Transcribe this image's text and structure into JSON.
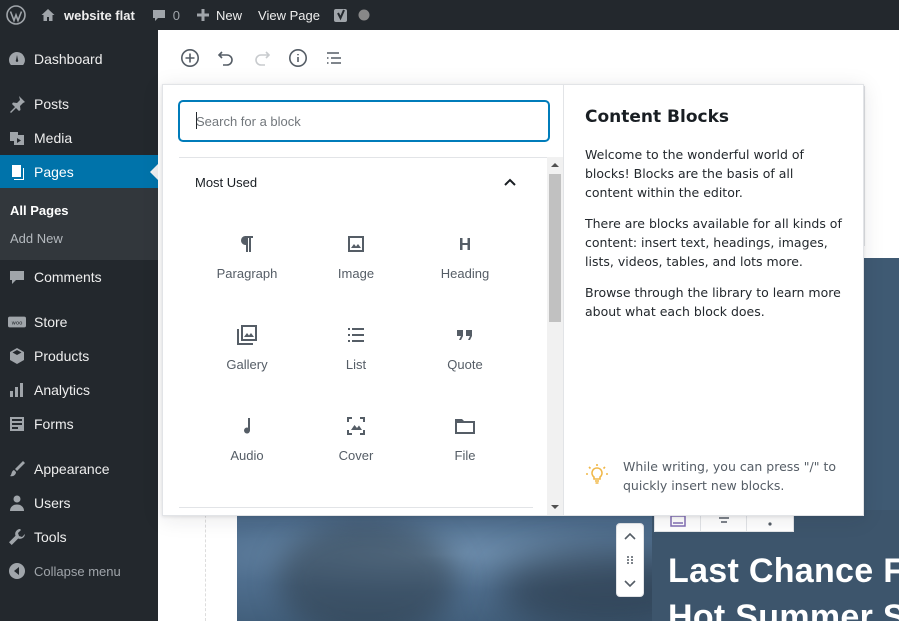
{
  "adminbar": {
    "site_name": "website flat",
    "comments_count": "0",
    "new_label": "New",
    "view_page_label": "View Page"
  },
  "sidebar": {
    "items": [
      {
        "label": "Dashboard",
        "icon": "dashboard-icon"
      },
      {
        "label": "Posts",
        "icon": "pin-icon"
      },
      {
        "label": "Media",
        "icon": "media-icon"
      },
      {
        "label": "Pages",
        "icon": "pages-icon"
      },
      {
        "label": "Comments",
        "icon": "comment-icon"
      },
      {
        "label": "Store",
        "icon": "woo-icon"
      },
      {
        "label": "Products",
        "icon": "box-icon"
      },
      {
        "label": "Analytics",
        "icon": "bar-chart-icon"
      },
      {
        "label": "Forms",
        "icon": "forms-icon"
      },
      {
        "label": "Appearance",
        "icon": "brush-icon"
      },
      {
        "label": "Users",
        "icon": "user-icon"
      },
      {
        "label": "Tools",
        "icon": "wrench-icon"
      }
    ],
    "submenu": {
      "all_pages": "All Pages",
      "add_new": "Add New"
    },
    "collapse_label": "Collapse menu",
    "accent_color": "#0073aa"
  },
  "inserter": {
    "search_placeholder": "Search for a block",
    "panel_title": "Most Used",
    "blocks": [
      {
        "label": "Paragraph",
        "icon": "paragraph-icon"
      },
      {
        "label": "Image",
        "icon": "image-icon"
      },
      {
        "label": "Heading",
        "icon": "heading-icon"
      },
      {
        "label": "Gallery",
        "icon": "gallery-icon"
      },
      {
        "label": "List",
        "icon": "list-icon"
      },
      {
        "label": "Quote",
        "icon": "quote-icon"
      },
      {
        "label": "Audio",
        "icon": "audio-icon"
      },
      {
        "label": "Cover",
        "icon": "cover-icon"
      },
      {
        "label": "File",
        "icon": "file-icon"
      }
    ],
    "help": {
      "title": "Content Blocks",
      "paragraphs": [
        "Welcome to the wonderful world of blocks! Blocks are the basis of all content within the editor.",
        "There are blocks available for all kinds of content: insert text, headings, images, lists, videos, tables, and lots more.",
        "Browse through the library to learn more about what each block does."
      ],
      "tip": "While writing, you can press \"/\" to quickly insert new blocks."
    }
  },
  "content": {
    "hero_title": "Last Chance Fo",
    "hero_subtitle": "Hot Summer S"
  }
}
